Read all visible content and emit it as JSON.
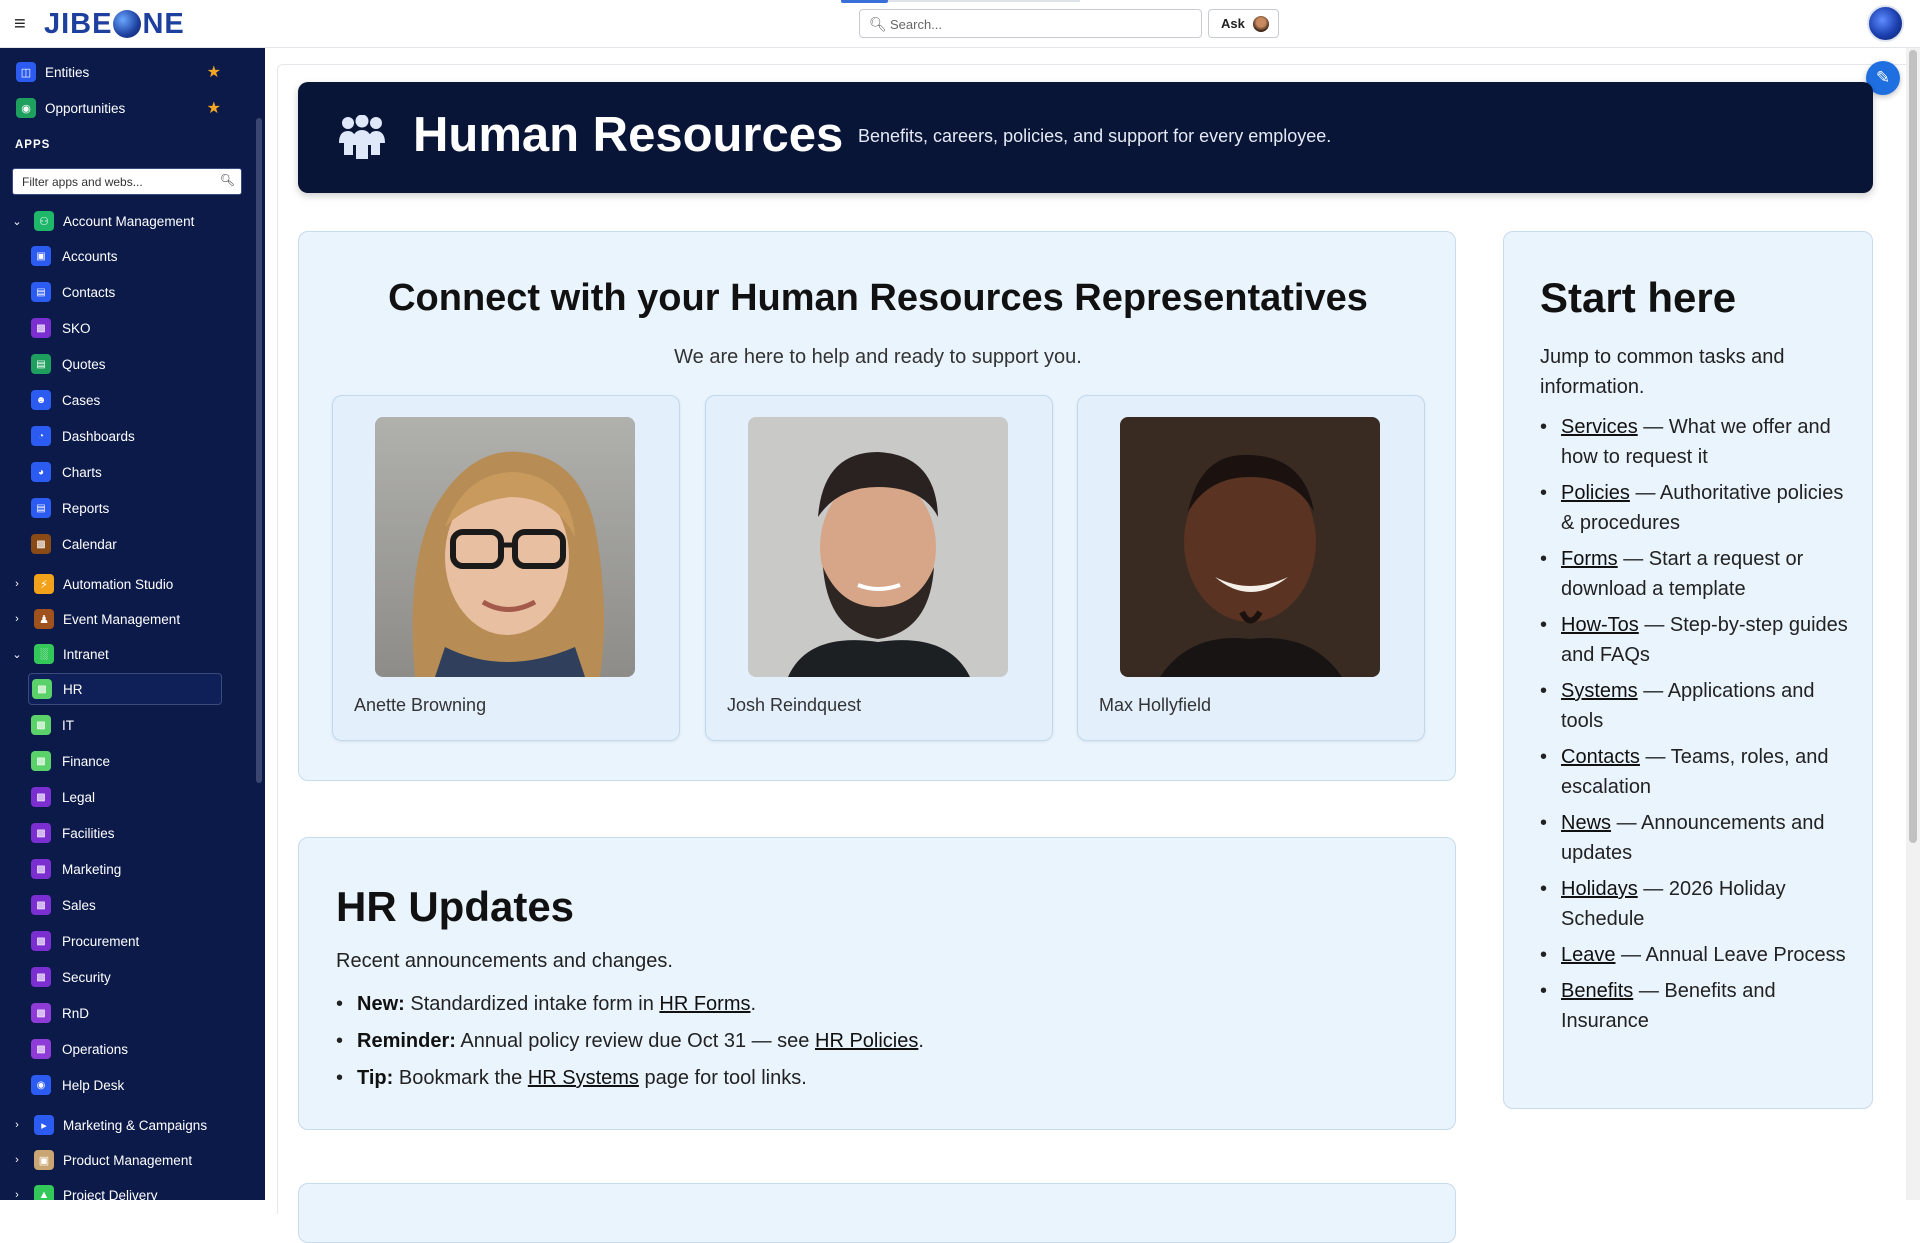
{
  "header": {
    "logo_text_left": "JIBE",
    "logo_text_right": "NE",
    "search_placeholder": "Search...",
    "ask_label": "Ask"
  },
  "sidebar": {
    "favorites": [
      {
        "label": "Entities",
        "icon": "database-icon",
        "color": "#2b5bf0"
      },
      {
        "label": "Opportunities",
        "icon": "map-pin-icon",
        "color": "#1e9f5e"
      }
    ],
    "apps_heading": "APPS",
    "filter_placeholder": "Filter apps and webs...",
    "groups": {
      "account_management": {
        "label": "Account Management",
        "expanded": true
      },
      "automation_studio": {
        "label": "Automation Studio",
        "expanded": false
      },
      "event_management": {
        "label": "Event Management",
        "expanded": false
      },
      "intranet": {
        "label": "Intranet",
        "expanded": true
      },
      "marketing_campaigns": {
        "label": "Marketing & Campaigns",
        "expanded": false
      },
      "product_management": {
        "label": "Product Management",
        "expanded": false
      },
      "project_delivery": {
        "label": "Project Delivery",
        "expanded": false
      }
    },
    "account_items": [
      "Accounts",
      "Contacts",
      "SKO",
      "Quotes",
      "Cases",
      "Dashboards",
      "Charts",
      "Reports",
      "Calendar"
    ],
    "intranet_items": [
      "HR",
      "IT",
      "Finance",
      "Legal",
      "Facilities",
      "Marketing",
      "Sales",
      "Procurement",
      "Security",
      "RnD",
      "Operations",
      "Help Desk"
    ],
    "active_item": "HR"
  },
  "hero": {
    "title": "Human Resources",
    "subtitle": "Benefits, careers, policies, and support for every employee."
  },
  "reps": {
    "title": "Connect with your Human Resources Representatives",
    "subtitle": "We are here to help and ready to support you.",
    "people": [
      {
        "name": "Anette Browning"
      },
      {
        "name": "Josh Reindquest"
      },
      {
        "name": "Max Hollyfield"
      }
    ]
  },
  "updates": {
    "title": "HR Updates",
    "subtitle": "Recent announcements and changes.",
    "items": [
      {
        "prefix": "New:",
        "text": " Standardized intake form in ",
        "link": "HR Forms",
        "suffix": "."
      },
      {
        "prefix": "Reminder:",
        "text": " Annual policy review due Oct 31 — see ",
        "link": "HR Policies",
        "suffix": "."
      },
      {
        "prefix": "Tip:",
        "text": " Bookmark the ",
        "link": "HR Systems",
        "suffix": " page for tool links."
      }
    ]
  },
  "start": {
    "title": "Start here",
    "subtitle": "Jump to common tasks and information.",
    "links": [
      {
        "link": "Services",
        "desc": " — What we offer and how to request it"
      },
      {
        "link": "Policies",
        "desc": " — Authoritative policies & procedures"
      },
      {
        "link": "Forms",
        "desc": " — Start a request or download a template"
      },
      {
        "link": "How-Tos",
        "desc": " — Step-by-step guides and FAQs"
      },
      {
        "link": "Systems",
        "desc": " — Applications and tools"
      },
      {
        "link": "Contacts",
        "desc": " — Teams, roles, and escalation"
      },
      {
        "link": "News",
        "desc": " — Announcements and updates"
      },
      {
        "link": "Holidays",
        "desc": " — 2026 Holiday Schedule"
      },
      {
        "link": "Leave",
        "desc": " — Annual Leave Process"
      },
      {
        "link": "Benefits",
        "desc": " — Benefits and Insurance"
      }
    ]
  }
}
